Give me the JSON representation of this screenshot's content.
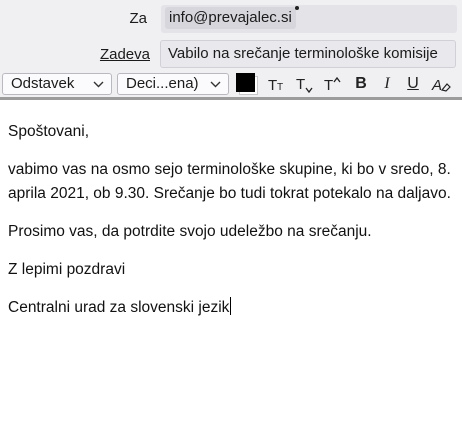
{
  "header": {
    "to_label": "Za",
    "recipient": "info@prevajalec.si",
    "subject_label": "Zadeva",
    "subject_value": "Vabilo na srečanje terminološke komisije"
  },
  "toolbar": {
    "paragraph_format": "Odstavek",
    "font_family": "Deci...ena)",
    "decrease_font_label": "T",
    "smaller_font_label": "T",
    "larger_font_label": "T",
    "bold_label": "B",
    "italic_label": "I",
    "underline_label": "U",
    "text_color": "#000000"
  },
  "body": {
    "greeting": "Spoštovani,",
    "paragraph1": "vabimo vas na osmo sejo terminološke skupine, ki bo v sredo, 8. aprila 2021, ob 9.30. Srečanje bo tudi tokrat potekalo na daljavo.",
    "paragraph2": "Prosimo vas, da potrdite svojo udeležbo na srečanju.",
    "closing": "Z lepimi pozdravi",
    "signature": "Centralni urad za slovenski jezik"
  }
}
